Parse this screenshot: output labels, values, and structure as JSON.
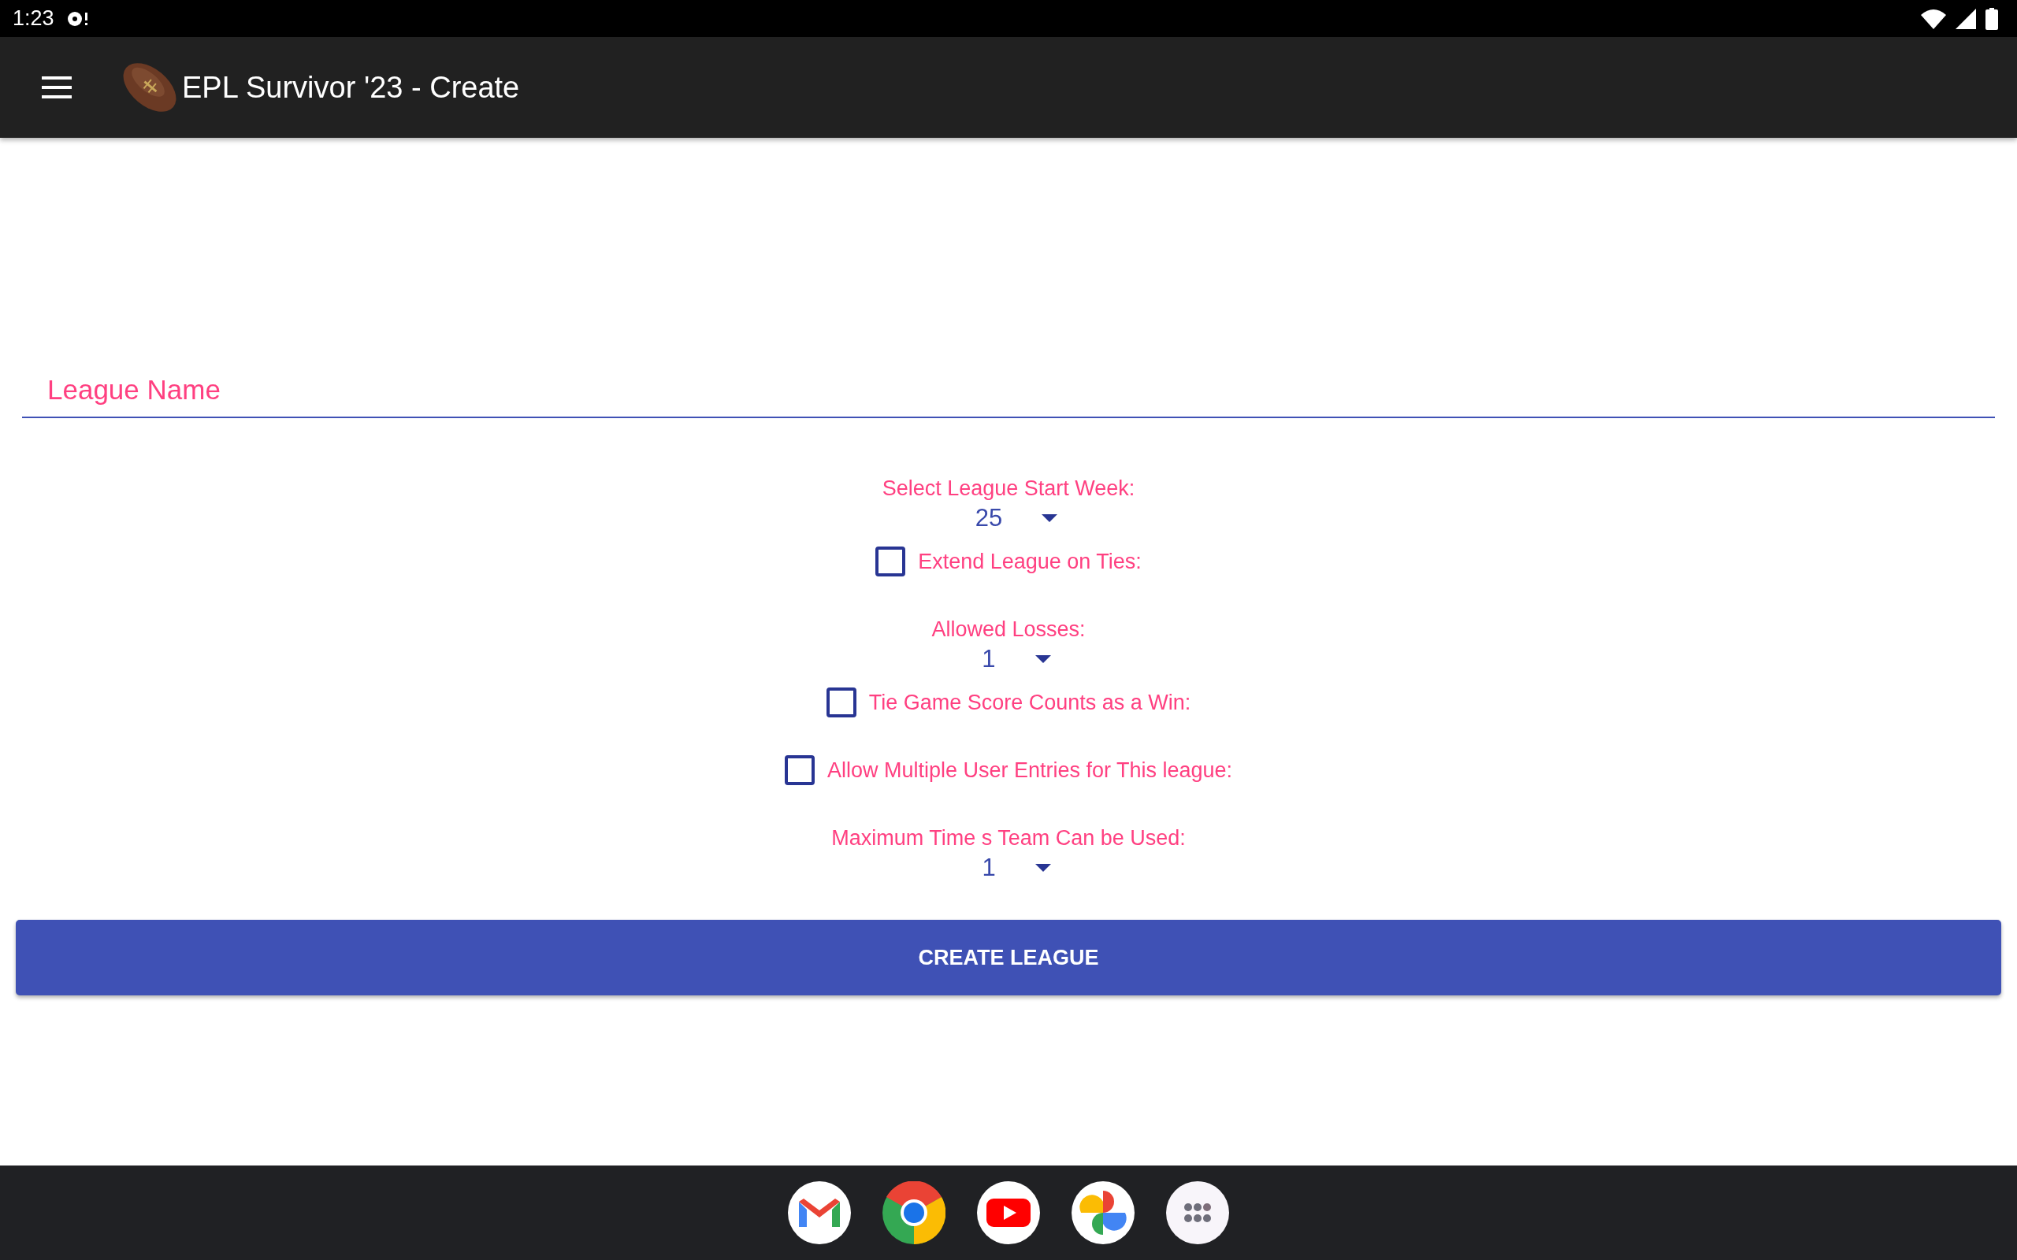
{
  "status_bar": {
    "time": "1:23"
  },
  "app_bar": {
    "title": "EPL Survivor '23 - Create"
  },
  "league_name": {
    "placeholder": "League Name"
  },
  "settings": [
    {
      "kind": "spinner",
      "label": "Select League Start Week:",
      "value": "25"
    },
    {
      "kind": "checkbox",
      "label": "Extend League on Ties:",
      "checked": false
    },
    {
      "kind": "spinner",
      "label": "Allowed Losses:",
      "value": "1"
    },
    {
      "kind": "checkbox",
      "label": "Tie Game Score Counts as a Win:",
      "checked": false
    },
    {
      "kind": "checkbox",
      "label": "Allow Multiple User Entries for This league:",
      "checked": false
    },
    {
      "kind": "spinner",
      "label": "Maximum Time s Team Can be Used:",
      "value": "1"
    }
  ],
  "create_button": {
    "label": "CREATE LEAGUE"
  }
}
